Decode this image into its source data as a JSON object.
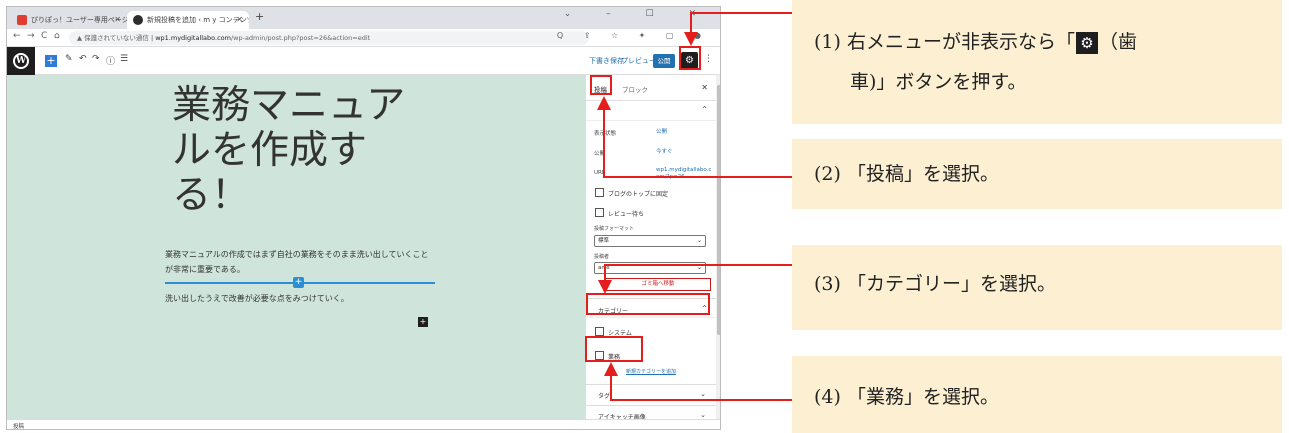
{
  "browser": {
    "tabs": [
      {
        "title": "ぴりぽっ！ユーザー専用ページ - Wo...",
        "icon": "app-favicon"
      },
      {
        "title": "新規投稿を追加 ‹ m y コンテンツフ...",
        "icon": "wordpress-favicon"
      }
    ],
    "new_tab": "+",
    "window_controls": "⌄ – ☐ ✕",
    "nav": {
      "back": "←",
      "forward": "→",
      "reload": "C",
      "home": "⌂"
    },
    "address": {
      "insecure_label": "▲ 保護されていない通信",
      "host": "wp1.mydigitallabo.com",
      "path": "/wp-admin/post.php?post=26&action=edit"
    },
    "addr_icons": "Q ⇪ ☆ ✦ ▢ ●"
  },
  "toolbar": {
    "logo": "W",
    "add": "+",
    "pen": "✎",
    "undo": "↶",
    "redo": "↷",
    "info": "ⓘ",
    "list": "☰",
    "save_draft": "下書き保存",
    "preview": "プレビュー",
    "publish": "公開",
    "settings": "⚙",
    "more": "⋮"
  },
  "editor": {
    "title": "業務マニュアルを作成する！",
    "paragraph1": "業務マニュアルの作成ではまず自社の業務をそのまま洗い出していくことが非常に重要である。",
    "paragraph2": "洗い出したうえで改善が必要な点をみつけていく。",
    "inserter": "+",
    "block_add": "+"
  },
  "sidebar": {
    "tab_post": "投稿",
    "tab_block": "ブロック",
    "close": "✕",
    "status_rows": [
      {
        "key": "表示状態",
        "value": "公開"
      },
      {
        "key": "公開",
        "value": "今すぐ"
      },
      {
        "key": "URL",
        "value": "wp1.mydigitallabo.com/?p=26"
      }
    ],
    "sticky_label": "ブログのトップに固定",
    "pending_label": "レビュー待ち",
    "format_label": "投稿フォーマット",
    "format_value": "標準",
    "author_label": "投稿者",
    "author_value": "ams",
    "trash": "ゴミ箱へ移動",
    "category_head": "カテゴリー",
    "categories": [
      "システム",
      "業務"
    ],
    "new_category": "新規カテゴリーを追加",
    "tag_head": "タグ",
    "featured_head": "アイキャッチ画像"
  },
  "statusbar": "投稿",
  "callouts": {
    "c1_line1_pre": "(1) 右メニューが非表示なら「",
    "c1_line1_post": "（歯",
    "c1_line2": "車)」ボタンを押す。",
    "c1_gear": "⚙",
    "c2": "(2) 「投稿」を選択。",
    "c3": "(3) 「カテゴリー」を選択。",
    "c4": "(4) 「業務」を選択。"
  },
  "colors": {
    "highlight": "#e41d1d",
    "callout_bg": "#fdf0d2",
    "canvas_bg": "#cfe5dc",
    "wp_blue": "#2271b1"
  }
}
